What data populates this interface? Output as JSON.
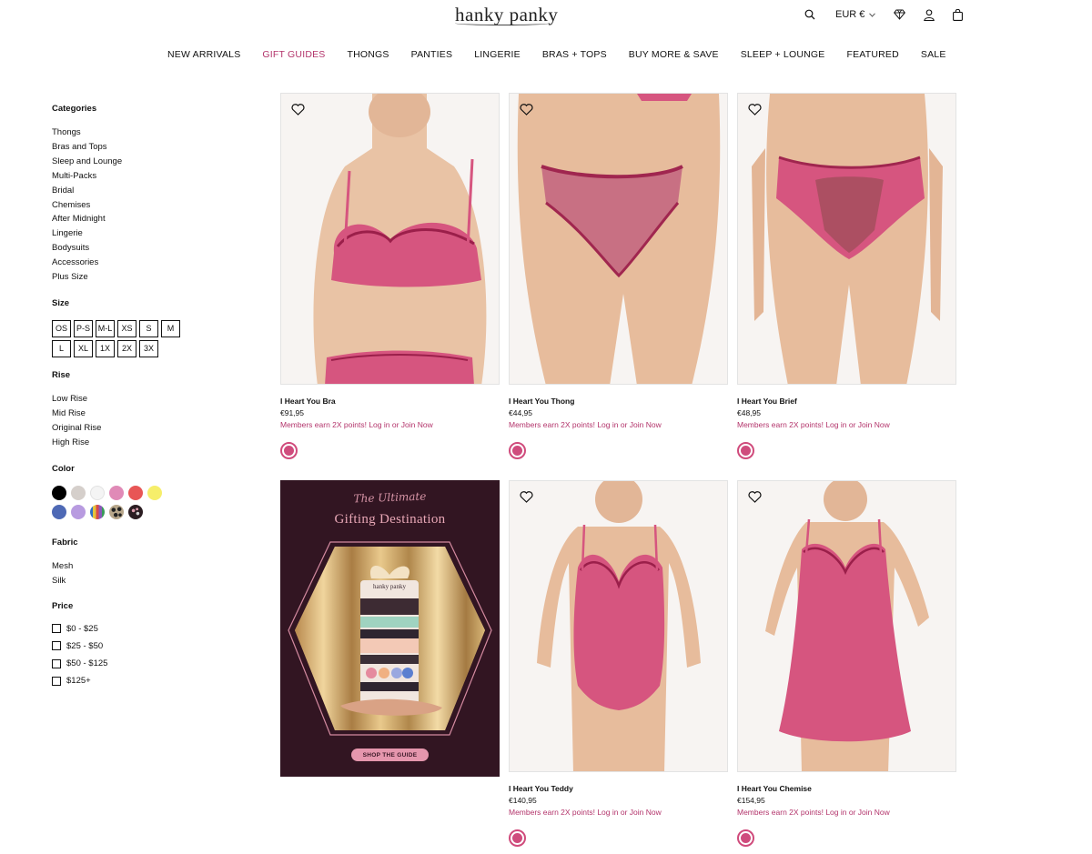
{
  "header": {
    "logo": "hanky panky",
    "currency": "EUR €"
  },
  "nav": [
    "NEW ARRIVALS",
    "GIFT GUIDES",
    "THONGS",
    "PANTIES",
    "LINGERIE",
    "BRAS + TOPS",
    "BUY MORE & SAVE",
    "SLEEP + LOUNGE",
    "FEATURED",
    "SALE"
  ],
  "nav_active": "GIFT GUIDES",
  "sidebar": {
    "categories_heading": "Categories",
    "categories": [
      "Thongs",
      "Bras and Tops",
      "Sleep and Lounge",
      "Multi-Packs",
      "Bridal",
      "Chemises",
      "After Midnight",
      "Lingerie",
      "Bodysuits",
      "Accessories",
      "Plus Size"
    ],
    "size_heading": "Size",
    "sizes": [
      "OS",
      "P-S",
      "M-L",
      "XS",
      "S",
      "M",
      "L",
      "XL",
      "1X",
      "2X",
      "3X"
    ],
    "rise_heading": "Rise",
    "rises": [
      "Low Rise",
      "Mid Rise",
      "Original Rise",
      "High Rise"
    ],
    "color_heading": "Color",
    "colors": [
      "#000000",
      "#d5cfcb",
      "#f4f4f4",
      "#e08ab7",
      "#e85656",
      "#f6ee6a",
      "#4e69b5",
      "#b89be0",
      "multi-stripe",
      "leopard",
      "dark-print"
    ],
    "fabric_heading": "Fabric",
    "fabrics": [
      "Mesh",
      "Silk"
    ],
    "price_heading": "Price",
    "prices": [
      "$0 - $25",
      "$25 - $50",
      "$50 - $125",
      "$125+"
    ]
  },
  "products": [
    {
      "name": "I Heart You Bra",
      "price": "€91,95",
      "promo": "Members earn 2X points! Log in or Join Now",
      "swatch": "#cf4c7d"
    },
    {
      "name": "I Heart You Thong",
      "price": "€44,95",
      "promo": "Members earn 2X points! Log in or Join Now",
      "swatch": "#cf4c7d"
    },
    {
      "name": "I Heart You Brief",
      "price": "€48,95",
      "promo": "Members earn 2X points! Log in or Join Now",
      "swatch": "#cf4c7d"
    },
    {
      "name": "I Heart You Teddy",
      "price": "€140,95",
      "promo": "Members earn 2X points! Log in or Join Now",
      "swatch": "#cf4c7d"
    },
    {
      "name": "I Heart You Chemise",
      "price": "€154,95",
      "promo": "Members earn 2X points! Log in or Join Now",
      "swatch": "#cf4c7d"
    }
  ],
  "promo_tile": {
    "kicker": "The Ultimate",
    "title": "Gifting Destination",
    "can_brand": "hanky panky",
    "cta": "SHOP THE GUIDE"
  },
  "icons": {
    "search": "search-icon",
    "rewards": "diamond-icon",
    "account": "user-icon",
    "bag": "shopping-bag-icon",
    "wishlist": "heart-icon"
  }
}
